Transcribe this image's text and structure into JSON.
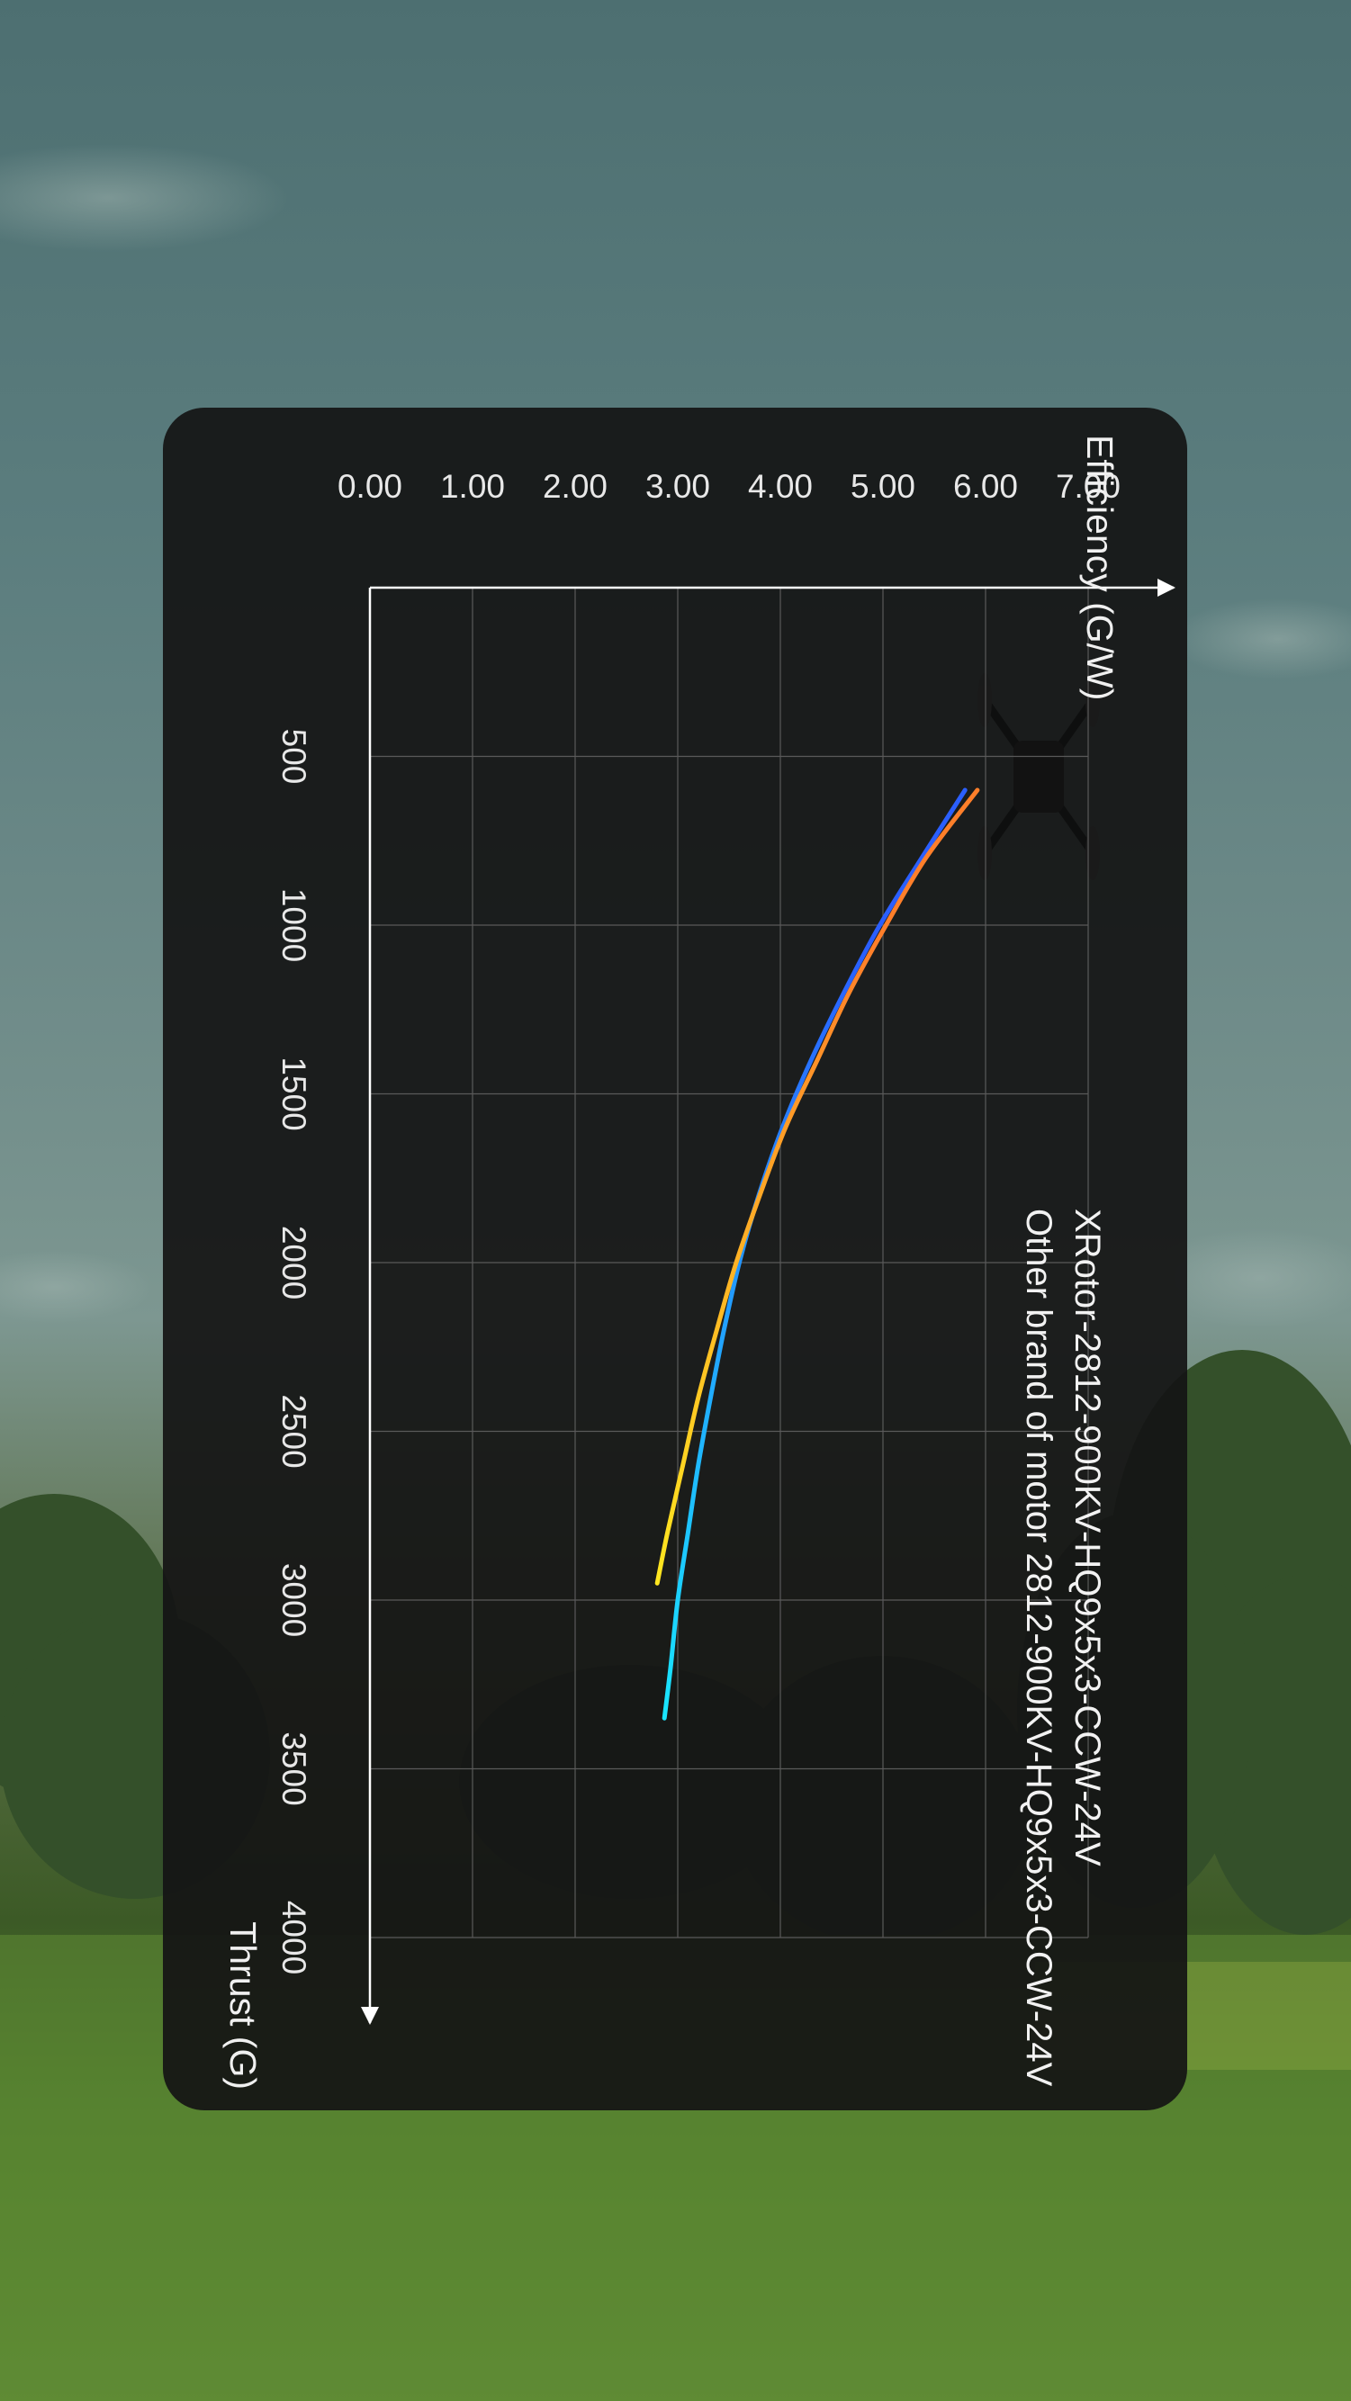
{
  "chart_data": {
    "type": "line",
    "xlabel": "Thrust (G)",
    "ylabel": "Efficiency (G/W)",
    "xlim": [
      0,
      4000
    ],
    "ylim": [
      0,
      7
    ],
    "xticks": [
      "500",
      "1000",
      "1500",
      "2000",
      "2500",
      "3000",
      "3500",
      "4000"
    ],
    "yticks": [
      "0.00",
      "1.00",
      "2.00",
      "3.00",
      "4.00",
      "5.00",
      "6.00",
      "7.00"
    ],
    "grid": true,
    "legend_position": "top-right",
    "series": [
      {
        "name": "XRotor-2812-900KV-HQ9x5x3-CCW-24V",
        "color_start": "#2b5fff",
        "color_end": "#19e6ff",
        "x": [
          600,
          800,
          1000,
          1200,
          1400,
          1600,
          1800,
          2000,
          2200,
          2400,
          2600,
          2800,
          3000,
          3200,
          3350
        ],
        "y": [
          5.8,
          5.38,
          4.97,
          4.62,
          4.3,
          4.02,
          3.79,
          3.6,
          3.45,
          3.32,
          3.2,
          3.1,
          3.0,
          2.93,
          2.87
        ]
      },
      {
        "name": "Other brand of motor 2812-900KV-HQ9x5x3-CCW-24V",
        "color_start": "#ff7f2a",
        "color_end": "#ffe620",
        "x": [
          600,
          800,
          1000,
          1200,
          1400,
          1600,
          1800,
          2000,
          2200,
          2400,
          2600,
          2800,
          2950
        ],
        "y": [
          5.92,
          5.42,
          5.03,
          4.67,
          4.36,
          4.05,
          3.8,
          3.57,
          3.38,
          3.2,
          3.05,
          2.9,
          2.8
        ]
      }
    ]
  }
}
